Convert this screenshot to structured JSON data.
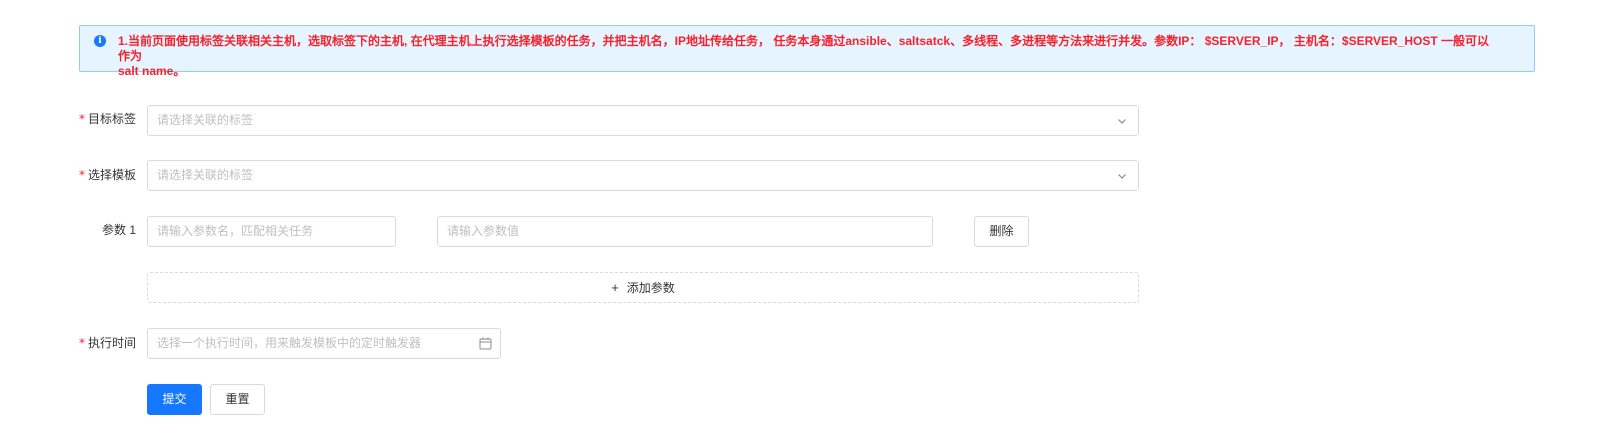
{
  "alert": {
    "icon": "info-icon",
    "text": "1.当前页面使用标签关联相关主机，选取标签下的主机, 在代理主机上执行选择模板的任务，并把主机名，IP地址传给任务， 任务本身通过ansible、saltsatck、多线程、多进程等方法来进行并发。参数IP： $SERVER_IP， 主机名：$SERVER_HOST 一般可以作为\nsalt name。"
  },
  "form": {
    "target_tag": {
      "label": "目标标签",
      "placeholder": "请选择关联的标签"
    },
    "template": {
      "label": "选择模板",
      "placeholder": "请选择关联的标签"
    },
    "param": {
      "label": "参数 1",
      "name_placeholder": "请输入参数名，匹配相关任务",
      "value_placeholder": "请输入参数值",
      "delete_label": "删除"
    },
    "add_param_label": "添加参数",
    "exec_time": {
      "label": "执行时间",
      "placeholder": "选择一个执行时间，用来触发模板中的定时触发器"
    },
    "submit_label": "提交",
    "reset_label": "重置"
  },
  "colors": {
    "primary": "#1677ff",
    "alert_text": "#f5222d",
    "alert_bg": "#e6f4ff",
    "alert_border": "#91caff"
  }
}
